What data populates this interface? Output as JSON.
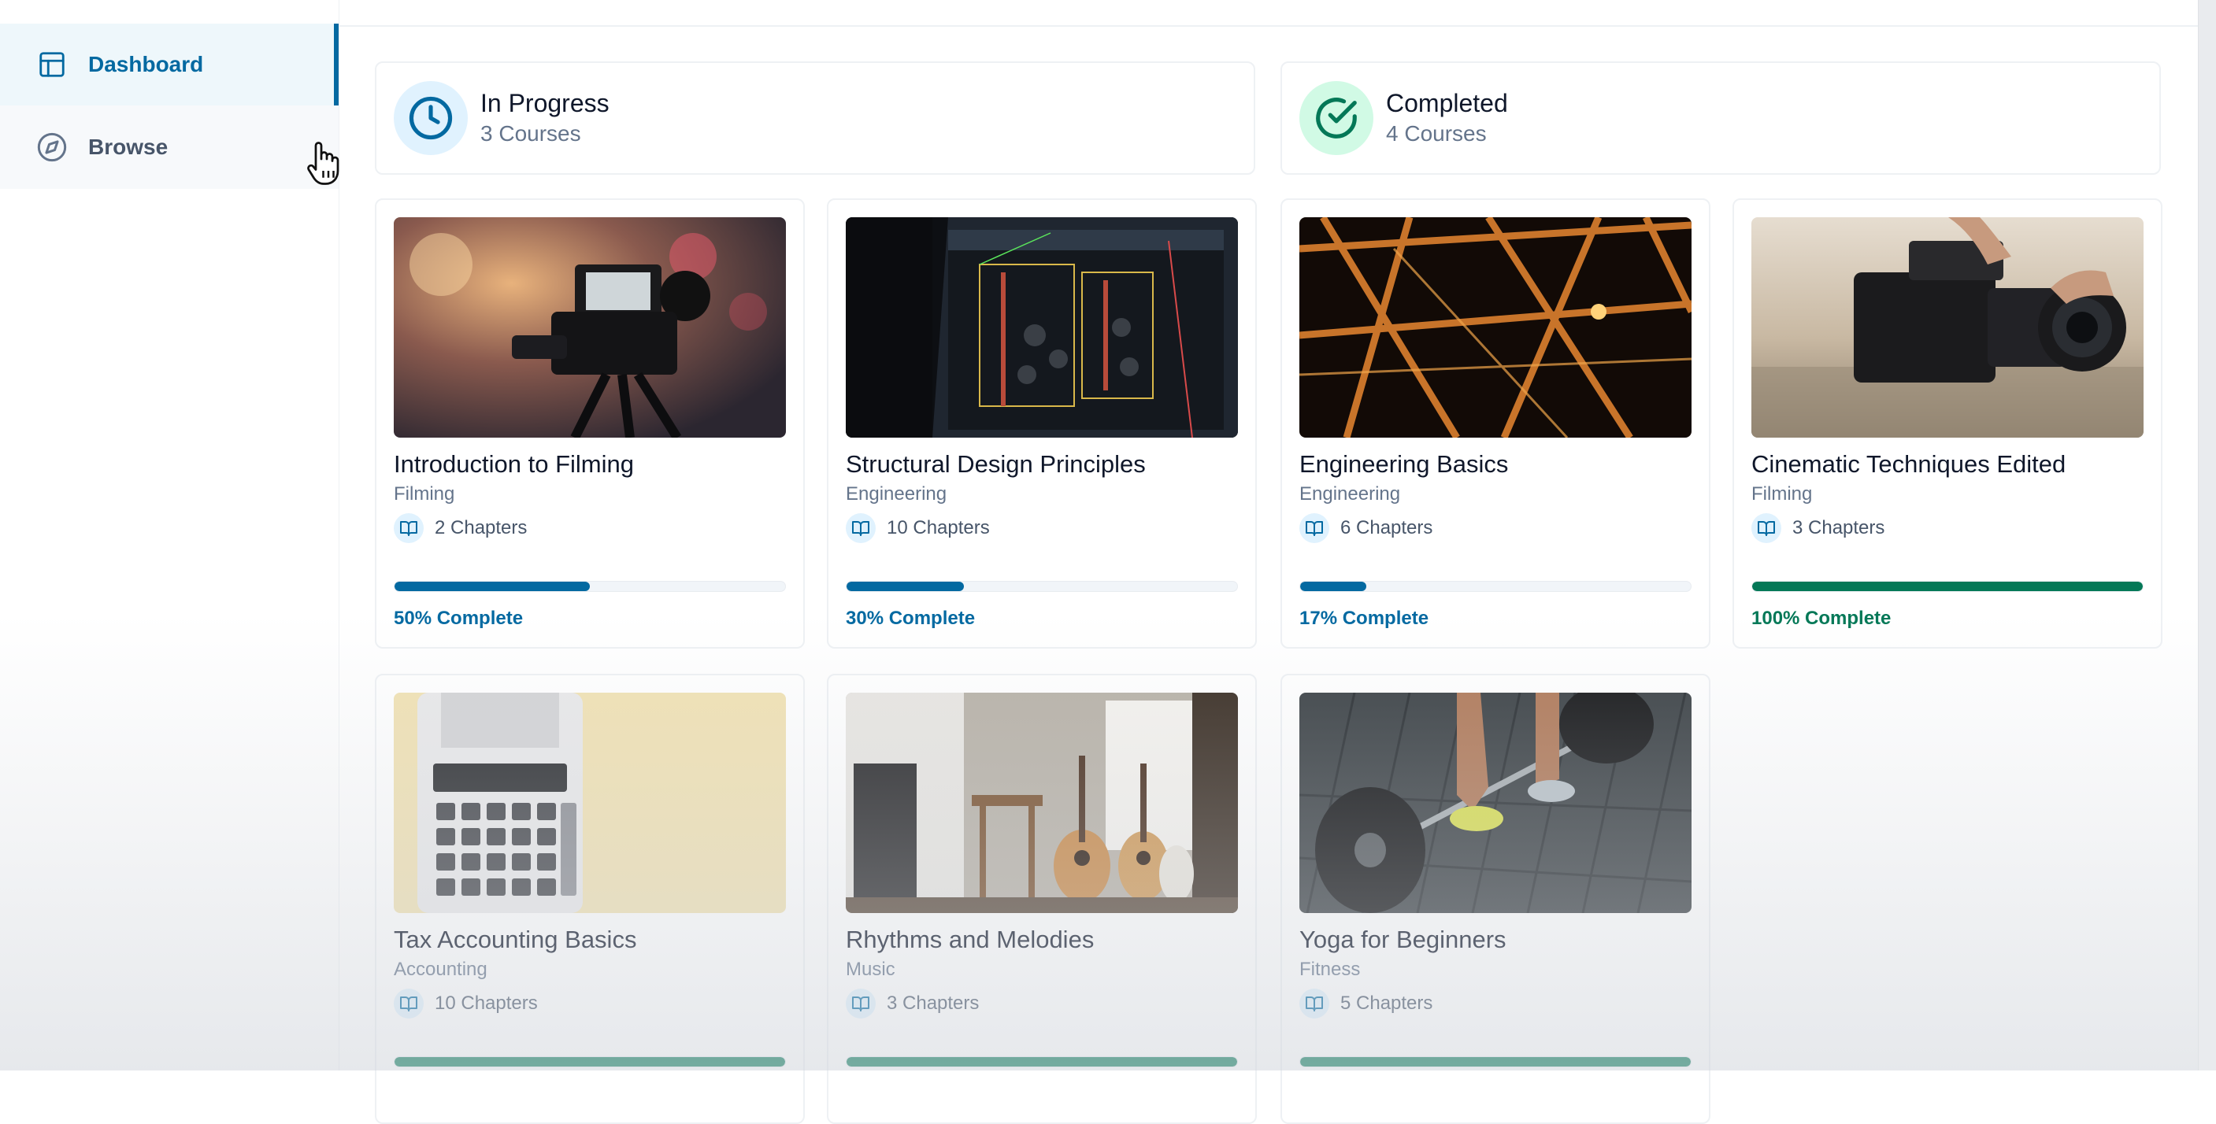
{
  "sidebar": {
    "items": [
      {
        "label": "Dashboard",
        "icon": "layout-icon",
        "active": true
      },
      {
        "label": "Browse",
        "icon": "compass-icon",
        "active": false
      }
    ]
  },
  "stats": {
    "in_progress": {
      "title": "In Progress",
      "subtitle": "3 Courses",
      "icon": "clock-icon",
      "color": "#0369a1"
    },
    "completed": {
      "title": "Completed",
      "subtitle": "4 Courses",
      "icon": "check-circle-icon",
      "color": "#047857"
    }
  },
  "colors": {
    "progress_blue": "#0369a1",
    "progress_green": "#047857",
    "pct_blue": "#0369a1",
    "pct_green": "#047857"
  },
  "courses": [
    {
      "title": "Introduction to Filming",
      "category": "Filming",
      "chapters": "2 Chapters",
      "progress_label": "50% Complete",
      "progress": 50,
      "image": "film-camera"
    },
    {
      "title": "Structural Design Principles",
      "category": "Engineering",
      "chapters": "10 Chapters",
      "progress_label": "30% Complete",
      "progress": 30,
      "image": "cad-screen"
    },
    {
      "title": "Engineering Basics",
      "category": "Engineering",
      "chapters": "6 Chapters",
      "progress_label": "17% Complete",
      "progress": 17,
      "image": "steel-truss"
    },
    {
      "title": "Cinematic Techniques Edited",
      "category": "Filming",
      "chapters": "3 Chapters",
      "progress_label": "100% Complete",
      "progress": 100,
      "image": "cinema-camera"
    },
    {
      "title": "Tax Accounting Basics",
      "category": "Accounting",
      "chapters": "10 Chapters",
      "progress_label": "",
      "progress": 100,
      "image": "calculator"
    },
    {
      "title": "Rhythms and Melodies",
      "category": "Music",
      "chapters": "3 Chapters",
      "progress_label": "",
      "progress": 100,
      "image": "guitars"
    },
    {
      "title": "Yoga for Beginners",
      "category": "Fitness",
      "chapters": "5 Chapters",
      "progress_label": "",
      "progress": 100,
      "image": "barbell"
    }
  ]
}
